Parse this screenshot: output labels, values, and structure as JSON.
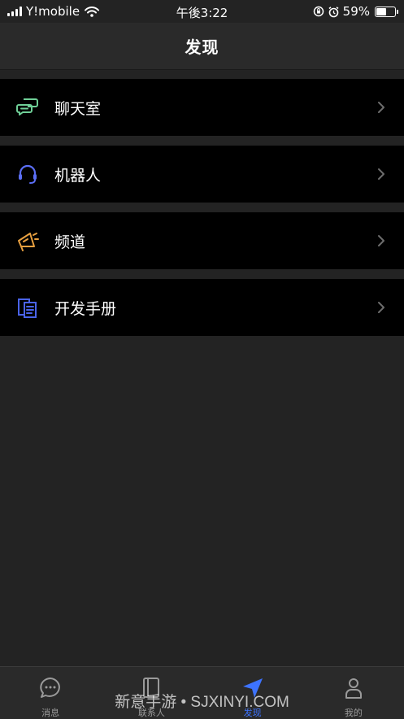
{
  "status_bar": {
    "carrier": "Y!mobile",
    "time": "午後3:22",
    "battery_percent": "59%",
    "battery_level": 0.59
  },
  "header": {
    "title": "发现"
  },
  "menu": {
    "items": [
      {
        "label": "聊天室",
        "icon": "chat-bubbles-icon",
        "icon_color": "#6fcf97"
      },
      {
        "label": "机器人",
        "icon": "headset-icon",
        "icon_color": "#5b6ef5"
      },
      {
        "label": "频道",
        "icon": "megaphone-icon",
        "icon_color": "#e8a040"
      },
      {
        "label": "开发手册",
        "icon": "documents-icon",
        "icon_color": "#4a63e8"
      }
    ]
  },
  "tab_bar": {
    "tabs": [
      {
        "label": "消息",
        "icon": "message-icon",
        "active": false
      },
      {
        "label": "联系人",
        "icon": "contacts-book-icon",
        "active": false
      },
      {
        "label": "发现",
        "icon": "navigation-arrow-icon",
        "active": true
      },
      {
        "label": "我的",
        "icon": "person-icon",
        "active": false
      }
    ],
    "active_color": "#3d73ff"
  },
  "watermark": "新意手游 • SJXINYI.COM"
}
